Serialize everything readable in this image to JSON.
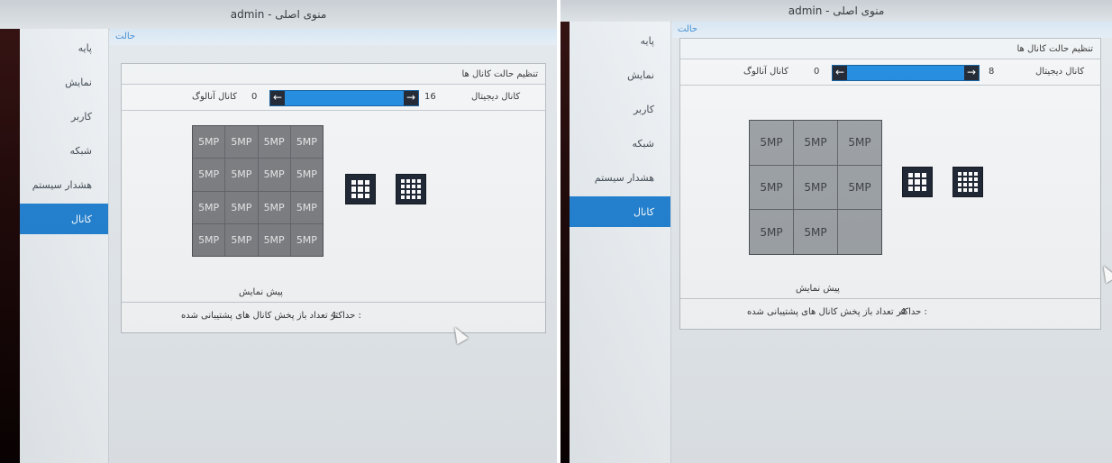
{
  "title": "admin - منوی اصلی",
  "photos": [
    {
      "breadcrumb": "حالت",
      "sidebar": [
        {
          "label": "پایه"
        },
        {
          "label": "نمایش"
        },
        {
          "label": "کاربر"
        },
        {
          "label": "شبکه"
        },
        {
          "label": "هشدار سیستم"
        },
        {
          "label": "کانال",
          "active": true
        }
      ],
      "panel_title": "تنظیم حالت کانال ها",
      "analog_label": "کانال آنالوگ",
      "analog_value": "0",
      "digital_value": "16",
      "digital_label": "کانال دیجیتال",
      "grid_cells": [
        "5MP",
        "5MP",
        "5MP",
        "5MP",
        "5MP",
        "5MP",
        "5MP",
        "5MP",
        "5MP",
        "5MP",
        "5MP",
        "5MP",
        "5MP",
        "5MP",
        "5MP",
        "5MP"
      ],
      "preview_label": "پیش نمایش",
      "footer_value": "4",
      "footer_text": "حداکثر تعداد باز پخش کانال های پشتیبانی شده :"
    },
    {
      "breadcrumb": "حالت",
      "sidebar": [
        {
          "label": "پایه"
        },
        {
          "label": "نمایش"
        },
        {
          "label": "کاربر"
        },
        {
          "label": "شبکه"
        },
        {
          "label": "هشدار سیستم"
        },
        {
          "label": "کانال",
          "active": true
        }
      ],
      "panel_title": "تنظیم حالت کانال ها",
      "analog_label": "کانال آنالوگ",
      "analog_value": "0",
      "digital_value": "8",
      "digital_label": "کانال دیجیتال",
      "grid_cells": [
        "5MP",
        "5MP",
        "5MP",
        "5MP",
        "5MP",
        "5MP",
        "5MP",
        "5MP",
        ""
      ],
      "preview_label": "پیش نمایش",
      "footer_value": "4",
      "footer_text": "حداکثر تعداد باز پخش کانال های پشتیبانی شده :"
    }
  ],
  "colors": {
    "accent": "#1e7fd0",
    "slider_fill": "#1e8ae0",
    "layout_button": "#1a2230"
  },
  "icons": [
    "arrow-left-icon",
    "arrow-right-icon",
    "grid-9-icon",
    "grid-16-icon",
    "mouse-cursor-icon"
  ]
}
